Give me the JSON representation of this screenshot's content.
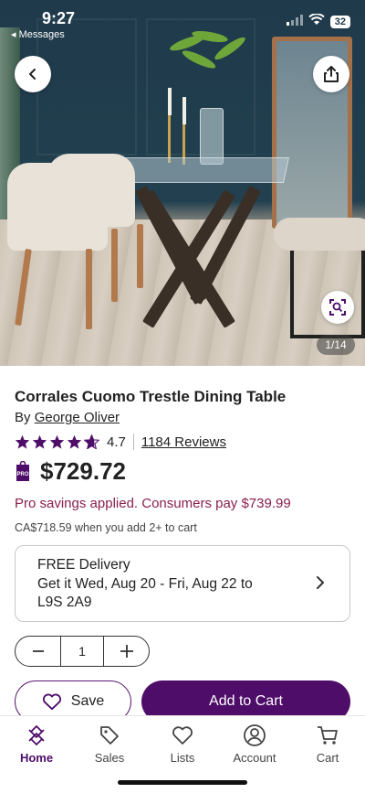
{
  "status_bar": {
    "time": "9:27",
    "back_label": "◂ Messages",
    "battery": "32"
  },
  "gallery": {
    "counter": "1/14"
  },
  "product": {
    "title": "Corrales Cuomo Trestle Dining Table",
    "by_prefix": "By",
    "brand": "George Oliver",
    "rating": "4.7",
    "rating_value": 4.7,
    "reviews": "1184 Reviews",
    "pro_badge": "PRO",
    "price": "$729.72",
    "savings": "Pro savings applied. Consumers pay $739.99",
    "cad_note": "CA$718.59 when you add 2+ to cart"
  },
  "delivery": {
    "line1": "FREE Delivery",
    "line2": "Get it Wed, Aug 20 - Fri, Aug 22 to",
    "line3": "L9S 2A9"
  },
  "quantity": {
    "value": "1"
  },
  "actions": {
    "save_label": "Save",
    "add_to_cart_label": "Add to Cart"
  },
  "nav": {
    "home": "Home",
    "sales": "Sales",
    "lists": "Lists",
    "account": "Account",
    "cart": "Cart"
  },
  "colors": {
    "brand": "#4d0d68",
    "savings": "#8a1f4d",
    "star": "#4d0d68"
  }
}
